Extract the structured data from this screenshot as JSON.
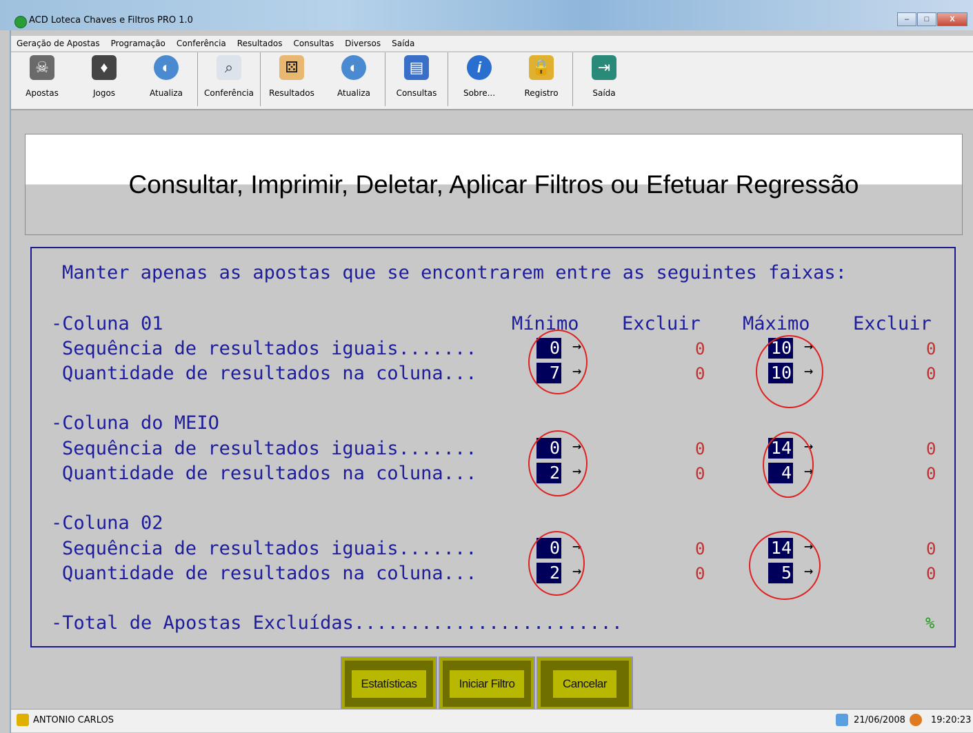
{
  "window": {
    "title": "ACD Loteca Chaves e Filtros PRO 1.0",
    "minimize": "–",
    "maximize": "□",
    "close": "X"
  },
  "menu": [
    "Geração de Apostas",
    "Programação",
    "Conferência",
    "Resultados",
    "Consultas",
    "Diversos",
    "Saída"
  ],
  "toolbar": [
    {
      "label": "Apostas",
      "icon": "skull-icon"
    },
    {
      "label": "Jogos",
      "icon": "cards-icon"
    },
    {
      "label": "Atualiza",
      "icon": "globe-icon"
    },
    {
      "label": "Conferência",
      "icon": "magnifier-icon"
    },
    {
      "label": "Resultados",
      "icon": "dice-icon"
    },
    {
      "label": "Atualiza",
      "icon": "globe-icon"
    },
    {
      "label": "Consultas",
      "icon": "folder-icon"
    },
    {
      "label": "Sobre...",
      "icon": "info-icon"
    },
    {
      "label": "Registro",
      "icon": "lock-icon"
    },
    {
      "label": "Saída",
      "icon": "exit-door-icon"
    }
  ],
  "heading": "Consultar, Imprimir, Deletar, Aplicar Filtros ou Efetuar Regressão",
  "filter": {
    "intro": "Manter apenas as apostas que se encontrarem entre as seguintes faixas:",
    "headers": {
      "min": "Mínimo",
      "excl1": "Excluir",
      "max": "Máximo",
      "excl2": "Excluir"
    },
    "sections": [
      {
        "title": "-Coluna 01",
        "rows": [
          {
            "label": "Sequência de resultados iguais.......",
            "min": "0",
            "excl_min": "0",
            "max": "10",
            "excl_max": "0"
          },
          {
            "label": "Quantidade de resultados na coluna...",
            "min": "7",
            "excl_min": "0",
            "max": "10",
            "excl_max": "0"
          }
        ]
      },
      {
        "title": "-Coluna do MEIO",
        "rows": [
          {
            "label": "Sequência de resultados iguais.......",
            "min": "0",
            "excl_min": "0",
            "max": "14",
            "excl_max": "0"
          },
          {
            "label": "Quantidade de resultados na coluna...",
            "min": "2",
            "excl_min": "0",
            "max": "4",
            "excl_max": "0"
          }
        ]
      },
      {
        "title": "-Coluna 02",
        "rows": [
          {
            "label": "Sequência de resultados iguais.......",
            "min": "0",
            "excl_min": "0",
            "max": "14",
            "excl_max": "0"
          },
          {
            "label": "Quantidade de resultados na coluna...",
            "min": "2",
            "excl_min": "0",
            "max": "5",
            "excl_max": "0"
          }
        ]
      }
    ],
    "total_label": "-Total de Apostas Excluídas........................",
    "total_pct": "%",
    "arrow": "→"
  },
  "buttons": {
    "stats": "Estatísticas",
    "start": "Iniciar Filtro",
    "cancel": "Cancelar"
  },
  "status": {
    "user": "ANTONIO CARLOS",
    "date": "21/06/2008",
    "time": "19:20:23"
  },
  "colors": {
    "highlight": "#00005a",
    "text_blue": "#1d1d9c",
    "exclude_red": "#c03030",
    "circle_red": "#e02020",
    "button_olive": "#b8b800"
  }
}
